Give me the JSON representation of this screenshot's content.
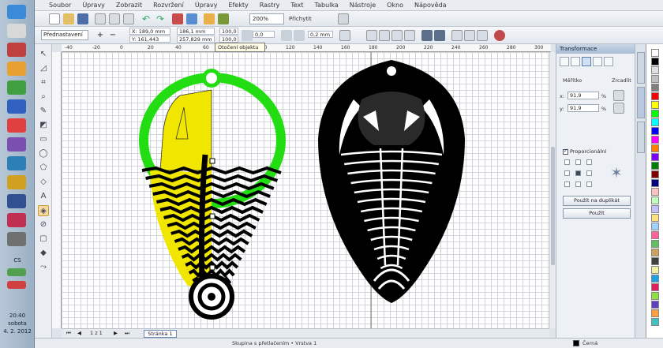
{
  "menu": {
    "items": [
      "Soubor",
      "Úpravy",
      "Zobrazit",
      "Rozvržení",
      "Úpravy",
      "Efekty",
      "Rastry",
      "Text",
      "Tabulka",
      "Nástroje",
      "Okno",
      "Nápověda"
    ]
  },
  "toolbar": {
    "zoom": "200%",
    "snap": "Přichytit"
  },
  "propbar": {
    "preset": "Přednastavení",
    "x": "X: 189,0 mm",
    "y": "Y: 161,443 mm",
    "w": "186,1 mm",
    "h": "257,829 mm",
    "scale_x": "100,0",
    "scale_y": "100,0",
    "angle": "0,0",
    "outline": "0,2 mm",
    "tooltip": "Otočení objektu"
  },
  "docker": {
    "title": "Transformace",
    "label_size": "Měřítko",
    "label_mirror": "Zrcadlit",
    "x_value": "91,9",
    "y_value": "91,9",
    "unit": "%",
    "proportional": "Proporcionální",
    "apply_copy": "Použít na duplikát",
    "apply": "Použít"
  },
  "ruler": {
    "ticks": [
      "-40",
      "-20",
      "0",
      "20",
      "40",
      "60",
      "80",
      "100",
      "120",
      "140",
      "160",
      "180",
      "200",
      "220",
      "240",
      "260",
      "280",
      "300"
    ]
  },
  "page_nav": {
    "counter": "1 z 1",
    "page_tab": "Stránka 1"
  },
  "status": {
    "text": "Skupina s přetlačením • Vrstva 1",
    "fill_label": "Černá"
  },
  "taskbar": {
    "clock_time": "20:40",
    "clock_day": "sobota",
    "clock_date": "4. 2. 2012",
    "lang": "CS"
  },
  "colors": {
    "green": "#22dd11",
    "yellow": "#f0e600",
    "black": "#000000"
  }
}
